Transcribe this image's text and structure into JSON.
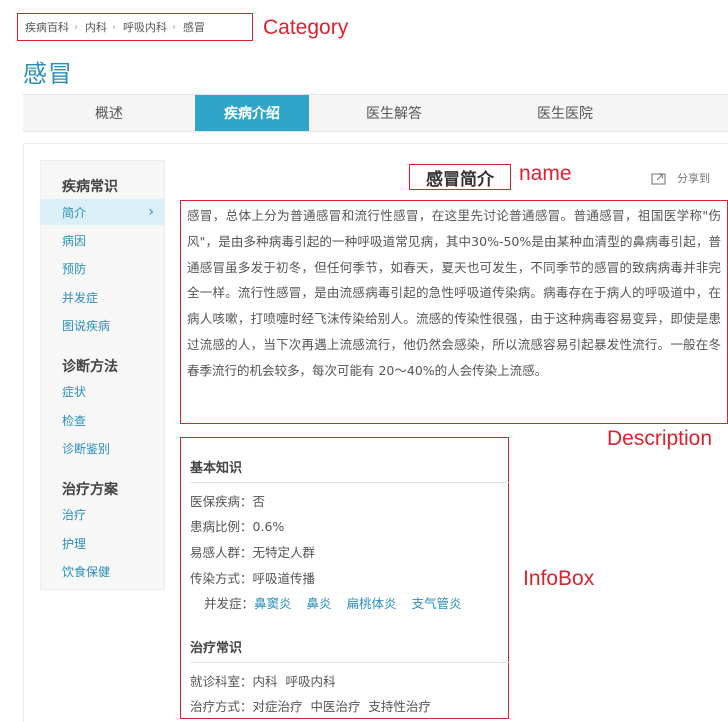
{
  "breadcrumb": [
    "疾病百科",
    "内科",
    "呼吸内科",
    "感冒"
  ],
  "annotations": {
    "category": "Category",
    "name": "name",
    "description": "Description",
    "infobox": "InfoBox"
  },
  "page_title": "感冒",
  "tabs": [
    {
      "label": "概述",
      "active": false
    },
    {
      "label": "疾病介绍",
      "active": true
    },
    {
      "label": "医生解答",
      "active": false
    },
    {
      "label": "医生医院",
      "active": false
    }
  ],
  "sidebar": {
    "sections": [
      {
        "heading": "疾病常识",
        "items": [
          "简介",
          "病因",
          "预防",
          "并发症",
          "图说疾病"
        ]
      },
      {
        "heading": "诊断方法",
        "items": [
          "症状",
          "检查",
          "诊断鉴别"
        ]
      },
      {
        "heading": "治疗方案",
        "items": [
          "治疗",
          "护理",
          "饮食保健"
        ]
      }
    ],
    "active_item": "简介"
  },
  "article": {
    "name": "感冒简介",
    "share_label": "分享到",
    "description": "感冒，总体上分为普通感冒和流行性感冒，在这里先讨论普通感冒。普通感冒，祖国医学称\"伤风\"，是由多种病毒引起的一种呼吸道常见病，其中30%-50%是由某种血清型的鼻病毒引起，普通感冒虽多发于初冬，但任何季节，如春天，夏天也可发生，不同季节的感冒的致病病毒并非完全一样。流行性感冒，是由流感病毒引起的急性呼吸道传染病。病毒存在于病人的呼吸道中，在病人咳嗽，打喷嚏时经飞沫传染给别人。流感的传染性很强，由于这种病毒容易变异，即使是患过流感的人，当下次再遇上流感流行，他仍然会感染，所以流感容易引起暴发性流行。一般在冬春季流行的机会较多，每次可能有 20～40%的人会传染上流感。"
  },
  "infobox": {
    "basic_heading": "基本知识",
    "rows": [
      {
        "label": "医保疾病：",
        "value": "否"
      },
      {
        "label": "患病比例：",
        "value": "0.6%"
      },
      {
        "label": "易感人群：",
        "value": "无特定人群"
      },
      {
        "label": "传染方式：",
        "value": "呼吸道传播"
      }
    ],
    "complication_label": "并发症：",
    "complications": [
      "鼻窦炎",
      "鼻炎",
      "扁桃体炎",
      "支气管炎"
    ],
    "treatment_heading": "治疗常识",
    "treatment_rows": [
      {
        "label": "就诊科室：",
        "value": "内科  呼吸内科"
      },
      {
        "label": "治疗方式：",
        "value": "对症治疗  中医治疗  支持性治疗"
      }
    ]
  },
  "colors": {
    "accent": "#2fa6c7",
    "link": "#2b8fb8",
    "annotation": "#d9232f"
  }
}
